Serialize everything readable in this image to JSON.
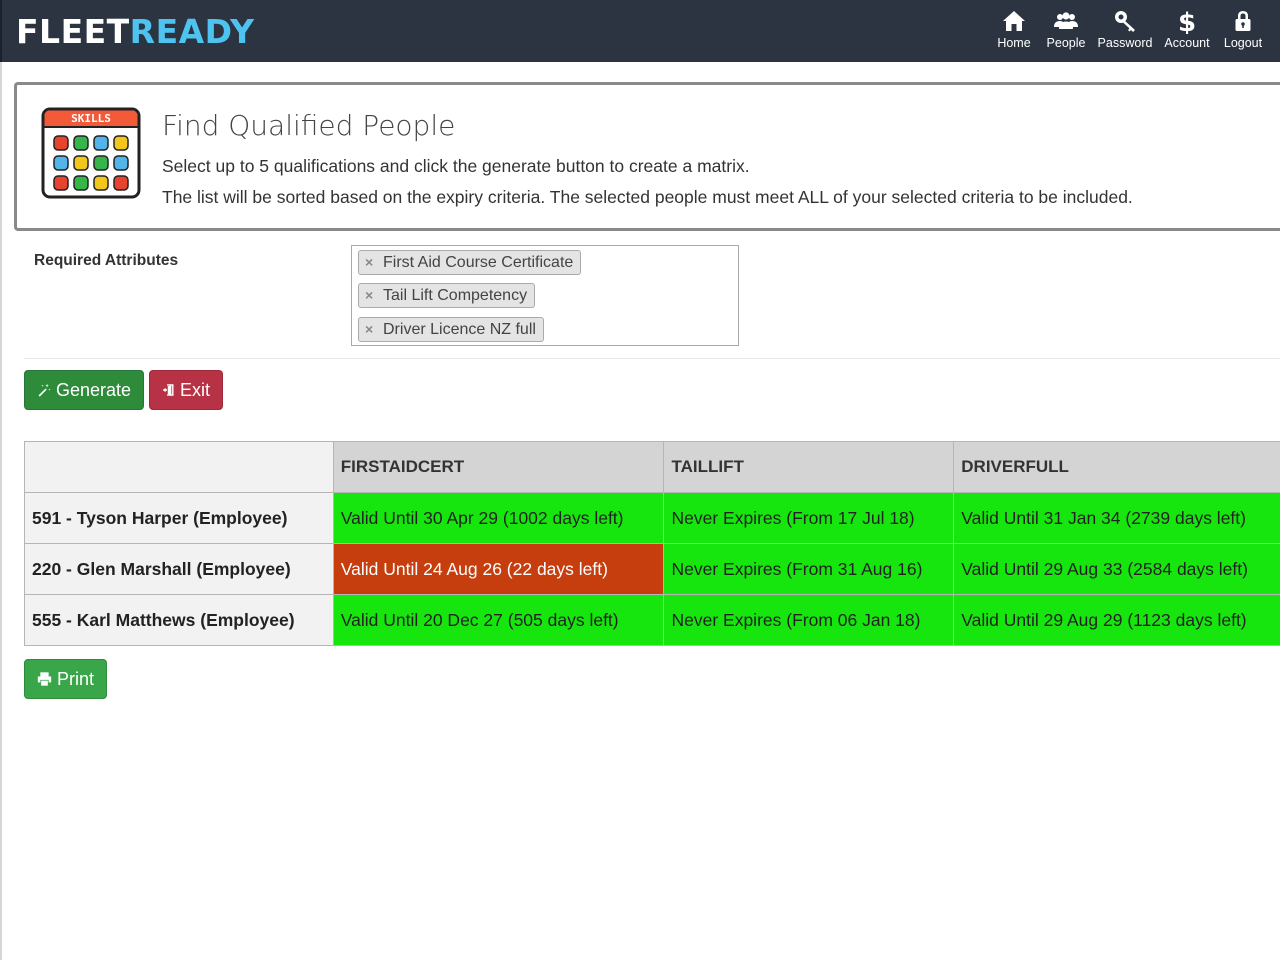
{
  "brand": {
    "part1": "FLEET",
    "part2": "READY"
  },
  "nav": [
    {
      "label": "Home",
      "icon": "home-icon"
    },
    {
      "label": "People",
      "icon": "people-icon"
    },
    {
      "label": "Password",
      "icon": "key-icon"
    },
    {
      "label": "Account",
      "icon": "dollar-icon"
    },
    {
      "label": "Logout",
      "icon": "lock-icon"
    }
  ],
  "panel": {
    "icon_text": "SKILLS",
    "title": "Find Qualified People",
    "line1": "Select up to 5 qualifications and click the generate button to create a matrix.",
    "line2": "The list will be sorted based on the expiry criteria. The selected people must meet ALL of your selected criteria to be included."
  },
  "required": {
    "label": "Required Attributes",
    "remove_glyph": "×",
    "chips": [
      "First Aid Course Certificate",
      "Tail Lift Competency",
      "Driver Licence NZ full"
    ]
  },
  "buttons": {
    "generate": "Generate",
    "exit": "Exit",
    "print": "Print"
  },
  "table": {
    "headers": [
      "",
      "FIRSTAIDCERT",
      "TAILLIFT",
      "DRIVERFULL"
    ],
    "rows": [
      {
        "person": "591 - Tyson Harper (Employee)",
        "cells": [
          {
            "text": "Valid Until 30 Apr 29 (1002 days left)",
            "status": "green"
          },
          {
            "text": "Never Expires (From 17 Jul 18)",
            "status": "green"
          },
          {
            "text": "Valid Until 31 Jan 34 (2739 days left)",
            "status": "green"
          }
        ]
      },
      {
        "person": "220 - Glen Marshall (Employee)",
        "cells": [
          {
            "text": "Valid Until 24 Aug 26 (22 days left)",
            "status": "red"
          },
          {
            "text": "Never Expires (From 31 Aug 16)",
            "status": "green"
          },
          {
            "text": "Valid Until 29 Aug 33 (2584 days left)",
            "status": "green"
          }
        ]
      },
      {
        "person": "555 - Karl Matthews (Employee)",
        "cells": [
          {
            "text": "Valid Until 20 Dec 27 (505 days left)",
            "status": "green"
          },
          {
            "text": "Never Expires (From 06 Jan 18)",
            "status": "green"
          },
          {
            "text": "Valid Until 29 Aug 29 (1123 days left)",
            "status": "green"
          }
        ]
      }
    ]
  },
  "colors": {
    "navbar": "#2c3442",
    "brand_accent": "#4fc3f0",
    "valid_green": "#17e60e",
    "expiring_red": "#c63e0d",
    "generate_btn": "#2e8b3a",
    "exit_btn": "#b83245",
    "print_btn": "#3aa64a"
  }
}
